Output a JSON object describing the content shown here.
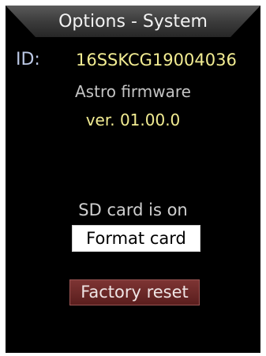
{
  "header": {
    "title": "Options - System"
  },
  "device": {
    "id_label": "ID:",
    "id_value": "16SSKCG19004036"
  },
  "firmware": {
    "label": "Astro firmware",
    "version": "ver. 01.00.0"
  },
  "sd_card": {
    "status": "SD card is on",
    "format_label": "Format card"
  },
  "actions": {
    "factory_reset_label": "Factory reset"
  },
  "colors": {
    "background": "#000000",
    "title_bar": "#3a3a3a",
    "value_text": "#f2ec92",
    "id_label": "#bcc9e6",
    "format_button": "#ffffff",
    "reset_button": "#6b2827"
  }
}
